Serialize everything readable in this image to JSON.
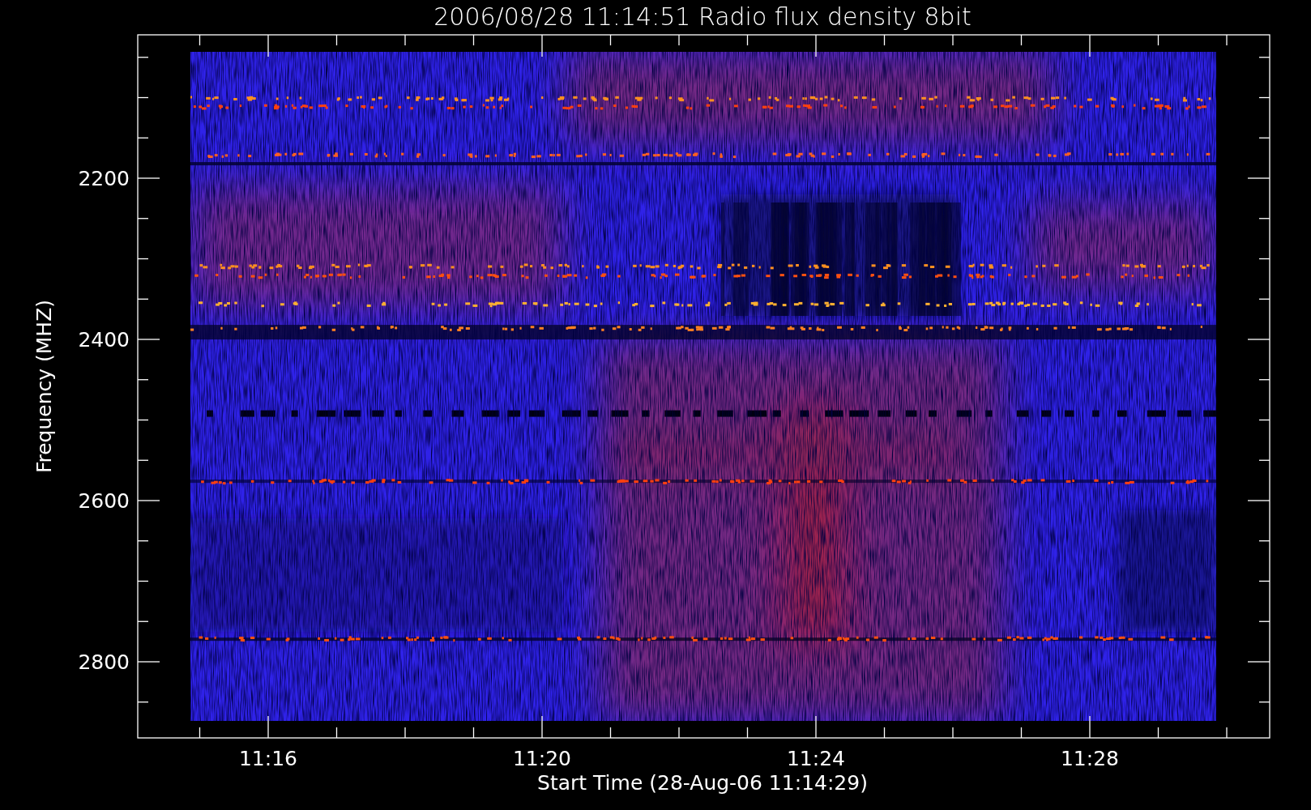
{
  "plot": {
    "title": "2006/08/28 11:14:51 Radio flux density 8bit",
    "y_axis": {
      "label": "Frequency (MHZ)",
      "tick_labels": [
        "2200",
        "2400",
        "2600",
        "2800"
      ]
    },
    "x_axis": {
      "label": "Start Time (28-Aug-06 11:14:29)",
      "tick_labels": [
        "11:16",
        "11:20",
        "11:24",
        "11:28"
      ]
    }
  }
}
